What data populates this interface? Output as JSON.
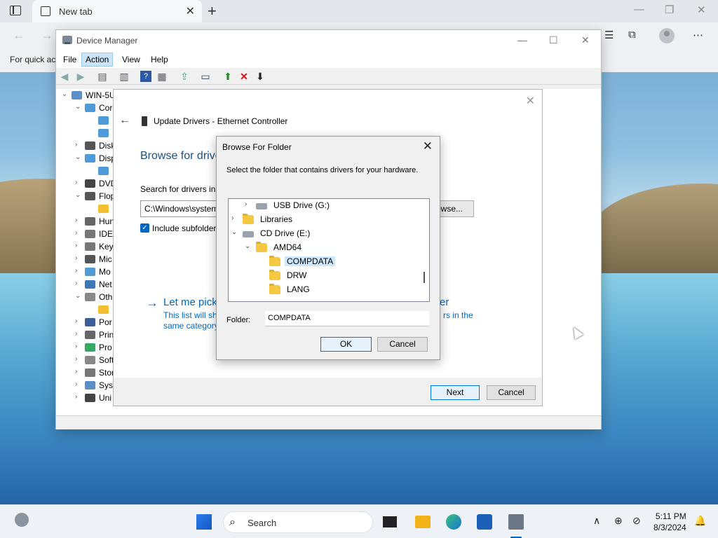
{
  "browser": {
    "tab_title": "New tab",
    "favorites_hint": "For quick ac"
  },
  "device_manager": {
    "title": "Device Manager",
    "menu": [
      "File",
      "Action",
      "View",
      "Help"
    ],
    "active_menu": "Action",
    "tree": [
      {
        "label": "WIN-5U",
        "indent": 0,
        "expander": "expanded",
        "icon": "computer-icon"
      },
      {
        "label": "Cor",
        "indent": 1,
        "expander": "expanded",
        "icon": "monitor-icon"
      },
      {
        "label": "",
        "indent": 2,
        "expander": "",
        "icon": "monitor-icon"
      },
      {
        "label": "",
        "indent": 2,
        "expander": "",
        "icon": "monitor-icon"
      },
      {
        "label": "Disk",
        "indent": 1,
        "expander": "collapsed",
        "icon": "disk-icon"
      },
      {
        "label": "Disp",
        "indent": 1,
        "expander": "expanded",
        "icon": "display-icon"
      },
      {
        "label": "",
        "indent": 2,
        "expander": "",
        "icon": "display-icon"
      },
      {
        "label": "DVD",
        "indent": 1,
        "expander": "collapsed",
        "icon": "dvd-icon"
      },
      {
        "label": "Flop",
        "indent": 1,
        "expander": "expanded",
        "icon": "floppy-icon"
      },
      {
        "label": "",
        "indent": 2,
        "expander": "",
        "icon": "warning-icon"
      },
      {
        "label": "Hun",
        "indent": 1,
        "expander": "collapsed",
        "icon": "hid-icon"
      },
      {
        "label": "IDE",
        "indent": 1,
        "expander": "collapsed",
        "icon": "ide-icon"
      },
      {
        "label": "Key",
        "indent": 1,
        "expander": "collapsed",
        "icon": "keyboard-icon"
      },
      {
        "label": "Mic",
        "indent": 1,
        "expander": "collapsed",
        "icon": "mouse-icon"
      },
      {
        "label": "Mo",
        "indent": 1,
        "expander": "collapsed",
        "icon": "monitor-icon"
      },
      {
        "label": "Net",
        "indent": 1,
        "expander": "collapsed",
        "icon": "network-icon"
      },
      {
        "label": "Oth",
        "indent": 1,
        "expander": "expanded",
        "icon": "other-devices-icon"
      },
      {
        "label": "",
        "indent": 2,
        "expander": "",
        "icon": "warning-icon"
      },
      {
        "label": "Por",
        "indent": 1,
        "expander": "collapsed",
        "icon": "port-icon"
      },
      {
        "label": "Prin",
        "indent": 1,
        "expander": "collapsed",
        "icon": "printer-icon"
      },
      {
        "label": "Pro",
        "indent": 1,
        "expander": "collapsed",
        "icon": "processor-icon"
      },
      {
        "label": "Soft",
        "indent": 1,
        "expander": "collapsed",
        "icon": "software-icon"
      },
      {
        "label": "Stor",
        "indent": 1,
        "expander": "collapsed",
        "icon": "storage-icon"
      },
      {
        "label": "Syst",
        "indent": 1,
        "expander": "collapsed",
        "icon": "system-icon"
      },
      {
        "label": "Uni",
        "indent": 1,
        "expander": "collapsed",
        "icon": "usb-icon"
      }
    ]
  },
  "wizard": {
    "title": "Update Drivers - Ethernet Controller",
    "heading": "Browse for drive",
    "search_label": "Search for drivers in t",
    "path_value": "C:\\Windows\\system",
    "browse_button": "owse...",
    "include_subfolders": "Include subfolder",
    "include_subfolders_checked": true,
    "let_me_pick": "Let me pick",
    "let_me_pick_tail": "er",
    "desc_line1": "This list will sh",
    "desc_line1_tail": "rs in the",
    "desc_line2": "same category",
    "next_button": "Next",
    "cancel_button": "Cancel"
  },
  "browse_folder": {
    "title": "Browse For Folder",
    "instruction": "Select the folder that contains drivers for your hardware.",
    "tree": [
      {
        "label": "USB Drive (G:)",
        "indent": 1,
        "expander": "collapsed",
        "icon": "usb-drive-icon",
        "selected": false
      },
      {
        "label": "Libraries",
        "indent": 0,
        "expander": "collapsed",
        "icon": "folder-icon",
        "selected": false
      },
      {
        "label": "CD Drive (E:)",
        "indent": 0,
        "expander": "expanded",
        "icon": "cd-drive-icon",
        "selected": false
      },
      {
        "label": "AMD64",
        "indent": 1,
        "expander": "expanded",
        "icon": "folder-icon",
        "selected": false
      },
      {
        "label": "COMPDATA",
        "indent": 2,
        "expander": "",
        "icon": "folder-icon",
        "selected": true
      },
      {
        "label": "DRW",
        "indent": 2,
        "expander": "",
        "icon": "folder-icon",
        "selected": false
      },
      {
        "label": "LANG",
        "indent": 2,
        "expander": "",
        "icon": "folder-icon",
        "selected": false
      }
    ],
    "folder_label": "Folder:",
    "folder_value": "COMPDATA",
    "ok_button": "OK",
    "cancel_button": "Cancel"
  },
  "taskbar": {
    "search_text": "Search",
    "time": "5:11 PM",
    "date": "8/3/2024"
  },
  "colors": {
    "accent": "#0067c0",
    "selection": "#cce8ff",
    "folder": "#f5c842"
  }
}
